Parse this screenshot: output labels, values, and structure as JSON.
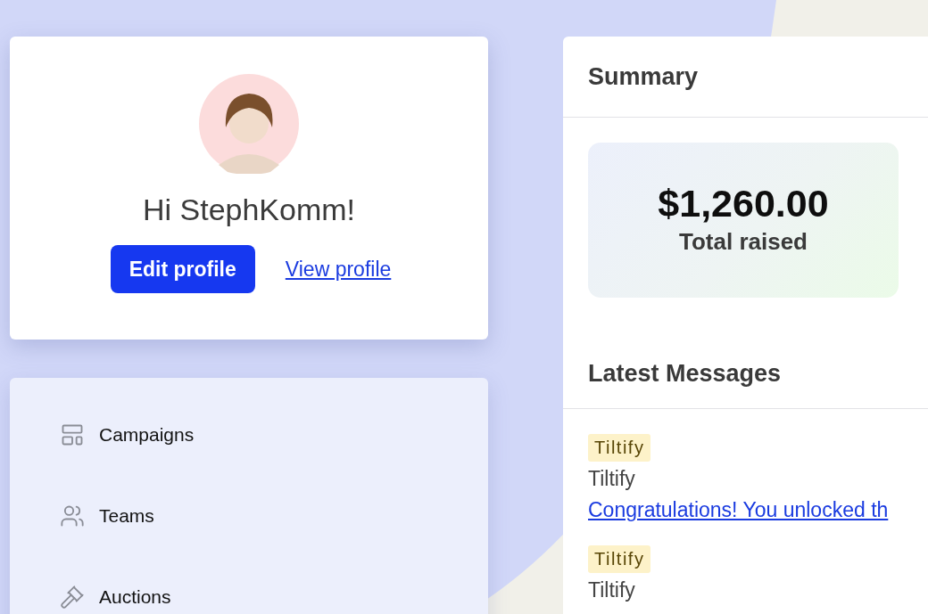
{
  "profile": {
    "greeting": "Hi StephKomm!",
    "edit_button": "Edit profile",
    "view_link": "View profile"
  },
  "nav": {
    "items": [
      {
        "label": "Campaigns",
        "kind": "layout"
      },
      {
        "label": "Teams",
        "kind": "users"
      },
      {
        "label": "Auctions",
        "kind": "gavel"
      }
    ]
  },
  "summary": {
    "title": "Summary",
    "stats": [
      {
        "value": "$1,260.00",
        "label": "Total raised"
      }
    ]
  },
  "messages": {
    "title": "Latest Messages",
    "items": [
      {
        "badge": "Tiltify",
        "sender": "Tiltify",
        "link": "Congratulations! You unlocked th"
      },
      {
        "badge": "Tiltify",
        "sender": "Tiltify"
      }
    ]
  }
}
